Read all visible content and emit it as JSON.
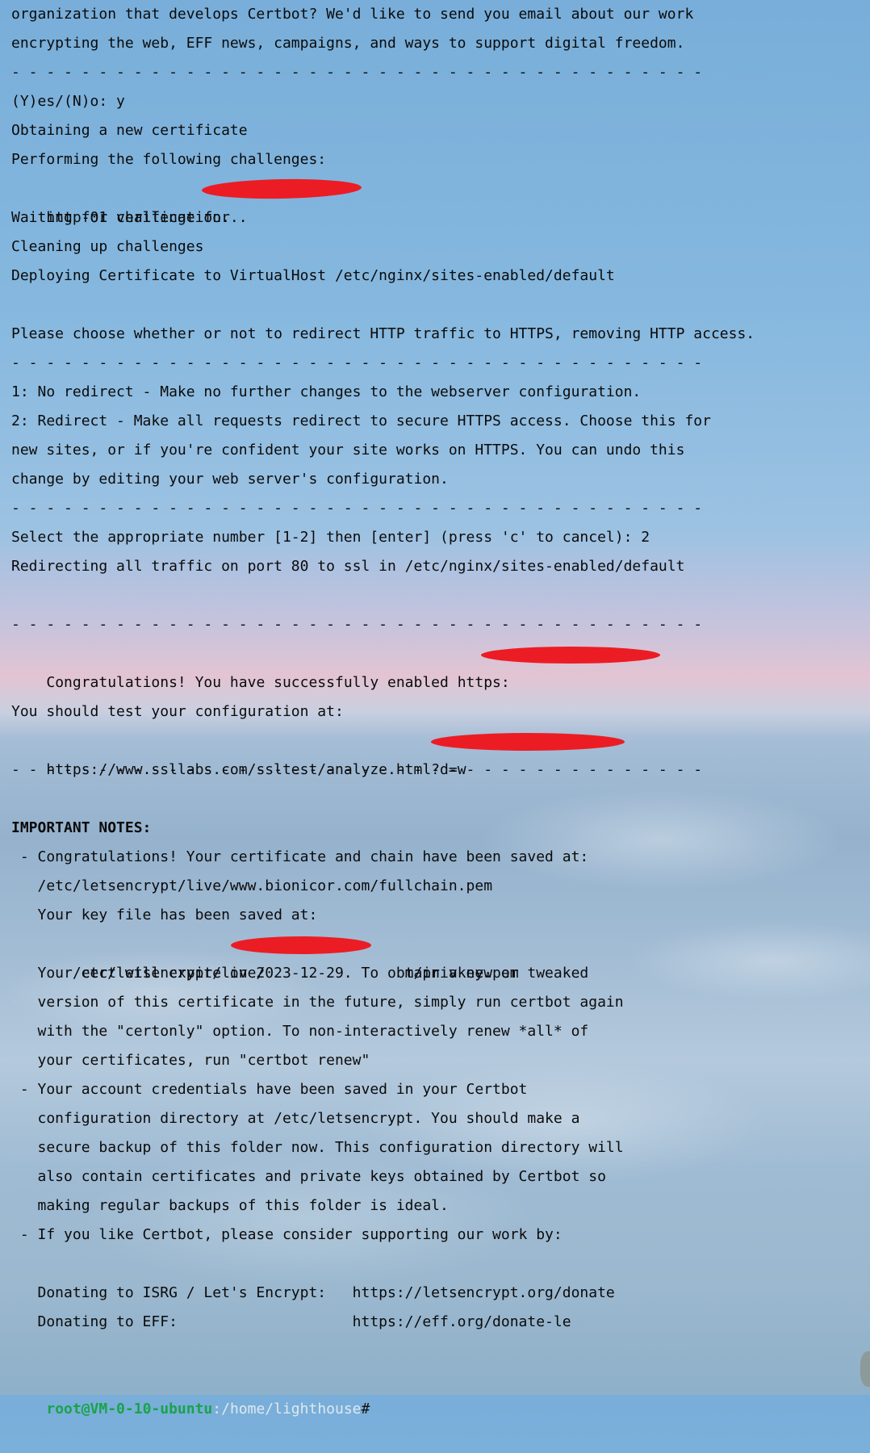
{
  "terminal": {
    "lines": [
      "organization that develops Certbot? We'd like to send you email about our work",
      "encrypting the web, EFF news, campaigns, and ways to support digital freedom.",
      "- - - - - - - - - - - - - - - - - - - - - - - - - - - - - - - - - - - - - - - -",
      "(Y)es/(N)o: y",
      "Obtaining a new certificate",
      "Performing the following challenges:",
      "http-01 challenge for",
      "Waiting for verification...",
      "Cleaning up challenges",
      "Deploying Certificate to VirtualHost /etc/nginx/sites-enabled/default",
      "",
      "Please choose whether or not to redirect HTTP traffic to HTTPS, removing HTTP access.",
      "- - - - - - - - - - - - - - - - - - - - - - - - - - - - - - - - - - - - - - - -",
      "1: No redirect - Make no further changes to the webserver configuration.",
      "2: Redirect - Make all requests redirect to secure HTTPS access. Choose this for",
      "new sites, or if you're confident your site works on HTTPS. You can undo this",
      "change by editing your web server's configuration.",
      "- - - - - - - - - - - - - - - - - - - - - - - - - - - - - - - - - - - - - - - -",
      "Select the appropriate number [1-2] then [enter] (press 'c' to cancel): 2",
      "Redirecting all traffic on port 80 to ssl in /etc/nginx/sites-enabled/default",
      "",
      "- - - - - - - - - - - - - - - - - - - - - - - - - - - - - - - - - - - - - - - -",
      "Congratulations! You have successfully enabled https:",
      "",
      "You should test your configuration at:",
      "https://www.ssllabs.com/ssltest/analyze.html?d=w",
      "- - - - - - - - - - - - - - - - - - - - - - - - - - - - - - - - - - - - - - - -",
      "",
      "IMPORTANT NOTES:",
      " - Congratulations! Your certificate and chain have been saved at:",
      "   /etc/letsencrypt/live/www.bionicor.com/fullchain.pem",
      "   Your key file has been saved at:",
      "   /etc/letsencrypt/live/                m/privkey.pem",
      "   Your cert will expire on 2023-12-29. To obtain a new or tweaked",
      "   version of this certificate in the future, simply run certbot again",
      "   with the \"certonly\" option. To non-interactively renew *all* of",
      "   your certificates, run \"certbot renew\"",
      " - Your account credentials have been saved in your Certbot",
      "   configuration directory at /etc/letsencrypt. You should make a",
      "   secure backup of this folder now. This configuration directory will",
      "   also contain certificates and private keys obtained by Certbot so",
      "   making regular backups of this folder is ideal.",
      " - If you like Certbot, please consider supporting our work by:",
      "",
      "   Donating to ISRG / Let's Encrypt:   https://letsencrypt.org/donate",
      "   Donating to EFF:                    https://eff.org/donate-le",
      ""
    ],
    "prompt": {
      "user_host": "root@VM-0-10-ubuntu",
      "separator": ":",
      "path": "/home/lighthouse",
      "symbol": "#"
    }
  }
}
